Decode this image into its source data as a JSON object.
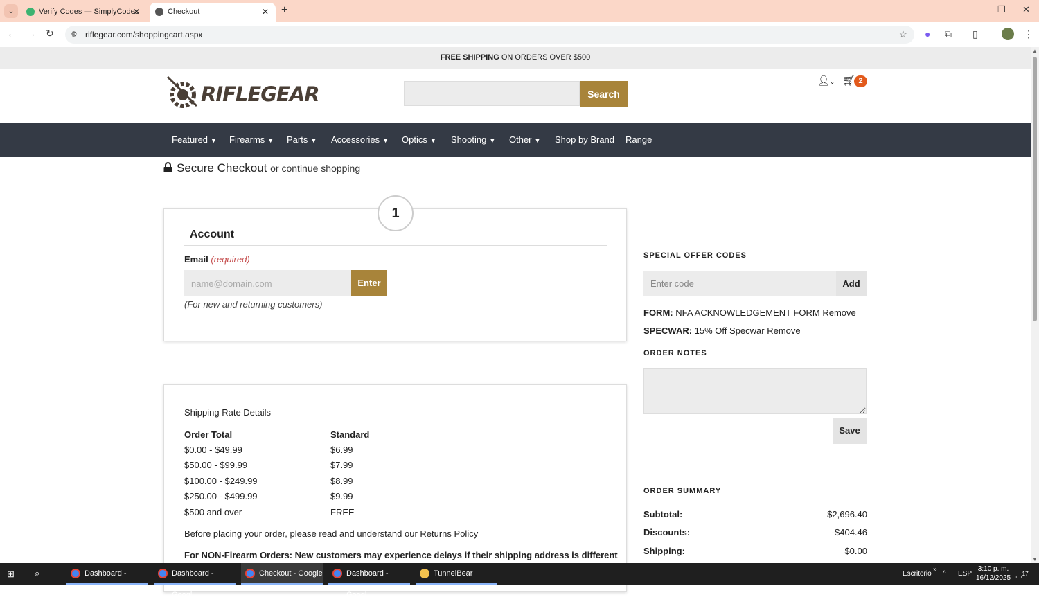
{
  "browser": {
    "tabs": [
      {
        "title": "Verify Codes — SimplyCodes",
        "active": false
      },
      {
        "title": "Checkout",
        "active": true
      }
    ],
    "url": "riflegear.com/shoppingcart.aspx"
  },
  "promo": {
    "bold": "FREE SHIPPING",
    "rest": " ON ORDERS OVER $500"
  },
  "header": {
    "logo_text": "RIFLEGEAR",
    "search_button": "Search",
    "cart_count": "2"
  },
  "nav": {
    "items": [
      {
        "label": "Featured",
        "dropdown": true
      },
      {
        "label": "Firearms",
        "dropdown": true
      },
      {
        "label": "Parts",
        "dropdown": true
      },
      {
        "label": "Accessories",
        "dropdown": true
      },
      {
        "label": "Optics",
        "dropdown": true
      },
      {
        "label": "Shooting",
        "dropdown": true
      },
      {
        "label": "Other",
        "dropdown": true
      },
      {
        "label": "Shop by Brand",
        "dropdown": false
      },
      {
        "label": "Range",
        "dropdown": false
      }
    ]
  },
  "checkout": {
    "title": "Secure Checkout",
    "continue_link": "or continue shopping",
    "step_number": "1",
    "account_title": "Account",
    "email_label": "Email",
    "email_required": "(required)",
    "email_placeholder": "name@domain.com",
    "enter_button": "Enter",
    "email_note": "(For new and returning customers)"
  },
  "shipping": {
    "title": "Shipping Rate Details",
    "col_order_total": "Order Total",
    "col_standard": "Standard",
    "rows": [
      {
        "range": "$0.00 - $49.99",
        "rate": "$6.99"
      },
      {
        "range": "$50.00 - $99.99",
        "rate": "$7.99"
      },
      {
        "range": "$100.00 - $249.99",
        "rate": "$8.99"
      },
      {
        "range": "$250.00 - $499.99",
        "rate": "$9.99"
      },
      {
        "range": "$500 and over",
        "rate": "FREE"
      }
    ],
    "policy_text": "Before placing your order, please read and understand our Returns Policy",
    "nonfirearm_text": "For NON-Firearm Orders: New customers may experience delays if their shipping address is different"
  },
  "sidebar": {
    "offer_heading": "SPECIAL OFFER CODES",
    "code_placeholder": "Enter code",
    "add_button": "Add",
    "applied": [
      {
        "code": "FORM:",
        "desc": " NFA ACKNOWLEDGEMENT FORM",
        "remove": " Remove"
      },
      {
        "code": "SPECWAR:",
        "desc": " 15% Off Specwar",
        "remove": " Remove"
      }
    ],
    "notes_heading": "ORDER NOTES",
    "save_button": "Save",
    "summary_heading": "ORDER SUMMARY",
    "summary": [
      {
        "label": "Subtotal:",
        "value": "$2,696.40"
      },
      {
        "label": "Discounts:",
        "value": "-$404.46"
      },
      {
        "label": "Shipping:",
        "value": "$0.00"
      }
    ]
  },
  "taskbar": {
    "apps": [
      {
        "label": "Dashboard - Googl...",
        "active": false
      },
      {
        "label": "Dashboard - Googl...",
        "active": false
      },
      {
        "label": "Checkout - Google ...",
        "active": true
      },
      {
        "label": "Dashboard - Googl...",
        "active": false
      },
      {
        "label": "TunnelBear",
        "active": false
      }
    ],
    "desktop_label": "Escritorio",
    "language": "ESP",
    "time": "3:10 p. m.",
    "date": "16/12/2025",
    "notifications": "17"
  },
  "colors": {
    "accent": "#a8843a",
    "nav_bg": "#343a45",
    "tab_bar": "#fbd7c8",
    "cart_badge": "#e25a1c"
  }
}
